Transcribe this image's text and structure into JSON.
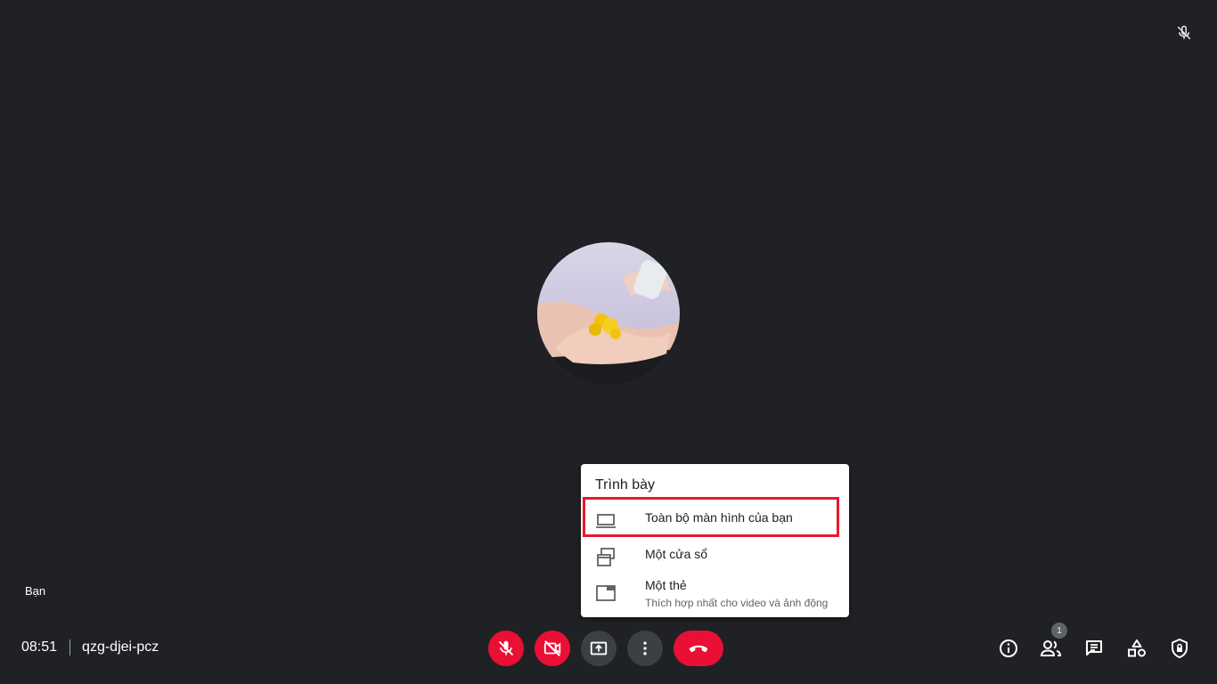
{
  "self_label": "Bạn",
  "time": "08:51",
  "meeting_code": "qzg-djei-pcz",
  "participants_count": "1",
  "present_menu": {
    "title": "Trình bày",
    "items": [
      {
        "label": "Toàn bộ màn hình của bạn",
        "icon": "laptop-icon"
      },
      {
        "label": "Một cửa sổ",
        "icon": "window-icon"
      },
      {
        "label": "Một thẻ",
        "sub": "Thích hợp nhất cho video và ảnh động",
        "icon": "tab-icon"
      }
    ]
  },
  "colors": {
    "background": "#202124",
    "danger": "#ea0f34",
    "control_grey": "#3c4043",
    "highlight": "#e8192c"
  }
}
